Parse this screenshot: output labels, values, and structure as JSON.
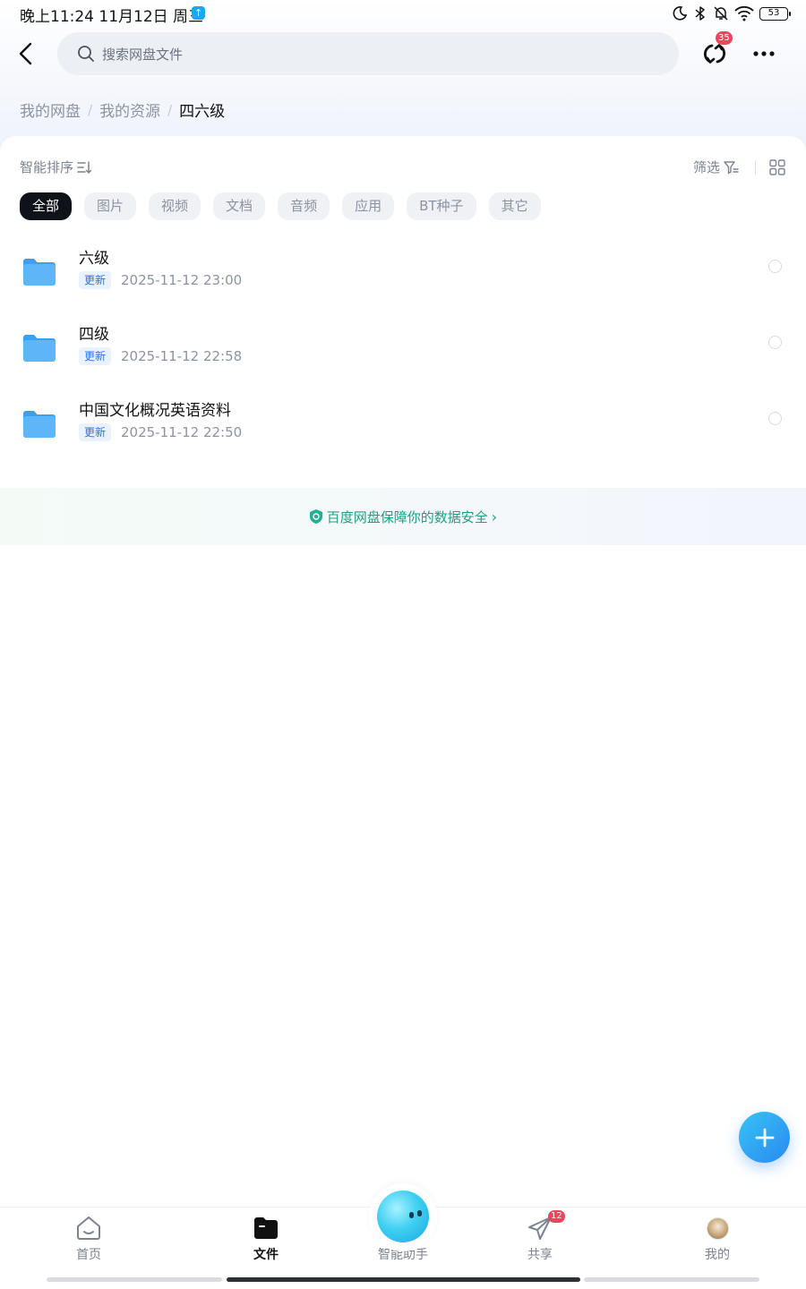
{
  "status_bar": {
    "time": "晚上11:24 11月12日 周三",
    "battery": "53"
  },
  "header": {
    "search_placeholder": "搜索网盘文件",
    "sync_badge": "35"
  },
  "breadcrumb": {
    "items": [
      "我的网盘",
      "我的资源"
    ],
    "separator": "/",
    "current": "四六级"
  },
  "toolbar": {
    "sort_label": "智能排序",
    "filter_label": "筛选"
  },
  "filter_chips": [
    {
      "label": "全部",
      "active": true
    },
    {
      "label": "图片",
      "active": false
    },
    {
      "label": "视频",
      "active": false
    },
    {
      "label": "文档",
      "active": false
    },
    {
      "label": "音频",
      "active": false
    },
    {
      "label": "应用",
      "active": false
    },
    {
      "label": "BT种子",
      "active": false
    },
    {
      "label": "其它",
      "active": false
    }
  ],
  "files": [
    {
      "name": "六级",
      "tag": "更新",
      "date": "2025-11-12  23:00"
    },
    {
      "name": "四级",
      "tag": "更新",
      "date": "2025-11-12  22:58"
    },
    {
      "name": "中国文化概况英语资料",
      "tag": "更新",
      "date": "2025-11-12  22:50"
    }
  ],
  "security_notice": "百度网盘保障你的数据安全",
  "bottom_nav": {
    "items": [
      {
        "label": "首页",
        "icon": "home-icon",
        "active": false
      },
      {
        "label": "文件",
        "icon": "folder-icon",
        "active": true
      },
      {
        "label": "智能助手",
        "icon": "assistant-icon",
        "active": false
      },
      {
        "label": "共享",
        "icon": "send-icon",
        "active": false
      },
      {
        "label": "我的",
        "icon": "avatar",
        "active": false
      }
    ],
    "share_badge": "12"
  },
  "colors": {
    "accent": "#2f6fe6",
    "active_chip": "#0f1218",
    "badge": "#f0435e",
    "security_green": "#1f9e84",
    "folder_blue": "#3aa0f2"
  }
}
